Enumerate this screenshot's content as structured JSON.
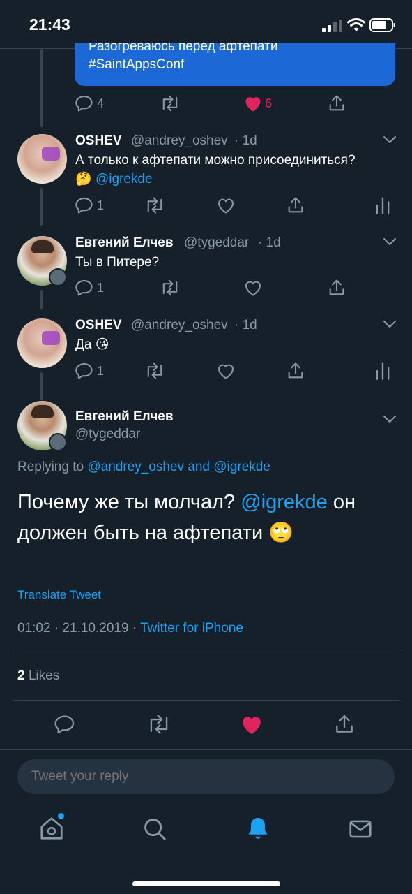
{
  "status_bar": {
    "time": "21:43"
  },
  "prev_tweet": {
    "text_line1": "Разогреваюсь перед афтепати",
    "text_line2": "#SaintAppsConf",
    "reply_count": "4",
    "like_count": "6",
    "liked": true
  },
  "replies": [
    {
      "name": "OSHEV",
      "handle": "@andrey_oshev",
      "time": "· 1d",
      "text": "А только к афтепати можно присоединиться?",
      "emoji": "🤔",
      "mention": "@igrekde",
      "reply_count": "1"
    },
    {
      "name": "Евгений Елчев",
      "handle": "@tygeddar",
      "time": "· 1d",
      "text": "Ты в Питере?",
      "reply_count": "1"
    },
    {
      "name": "OSHEV",
      "handle": "@andrey_oshev",
      "time": "· 1d",
      "text": "Да",
      "emoji": "😘",
      "reply_count": "1"
    }
  ],
  "main_tweet": {
    "name": "Евгений Елчев",
    "handle": "@tygeddar",
    "replying_prefix": "Replying to",
    "replying_user1": "@andrey_oshev",
    "replying_and": "and",
    "replying_user2": "@igrekde",
    "text_part1": "Почему же ты молчал?",
    "text_mention": "@igrekde",
    "text_part2": "он",
    "text_line2": "должен быть на афтепати",
    "text_emoji": "🙄",
    "translate": "Translate Tweet",
    "timestamp": "01:02 · 21.10.2019 ·",
    "source": "Twitter for iPhone",
    "likes_count": "2",
    "likes_label": "Likes"
  },
  "reply_input": {
    "placeholder": "Tweet your reply"
  },
  "colors": {
    "background": "#15202b",
    "accent": "#1da1f2",
    "like": "#e0245e",
    "muted": "#8899a6",
    "border": "#38444d"
  },
  "tab_bar": [
    "home-icon",
    "search-icon",
    "notifications-icon",
    "messages-icon"
  ]
}
